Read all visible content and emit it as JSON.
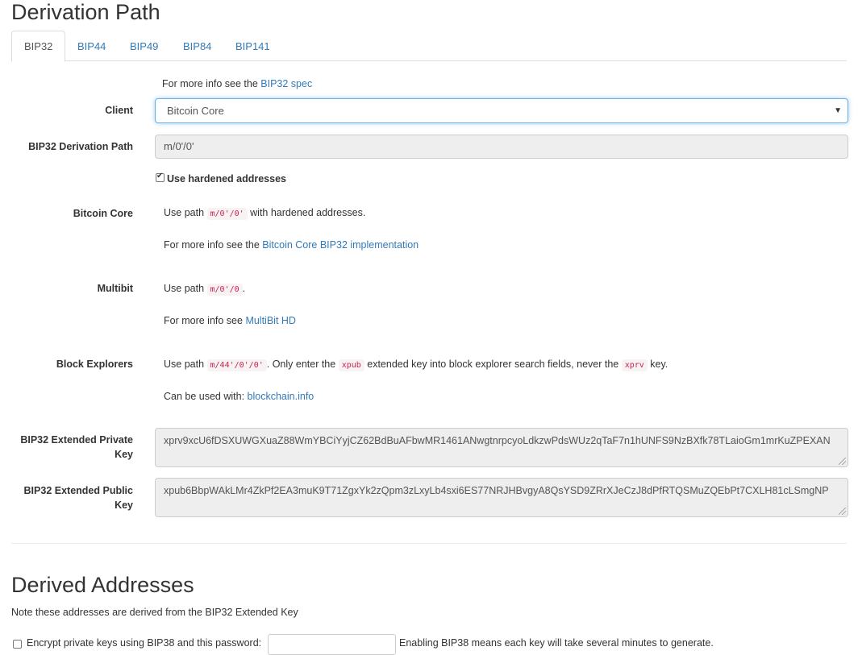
{
  "header": {
    "title": "Derivation Path"
  },
  "tabs": [
    {
      "label": "BIP32",
      "active": true
    },
    {
      "label": "BIP44"
    },
    {
      "label": "BIP49"
    },
    {
      "label": "BIP84"
    },
    {
      "label": "BIP141"
    }
  ],
  "bip32": {
    "info_prefix": "For more info see the ",
    "info_link": "BIP32 spec",
    "client_label": "Client",
    "client_value": "Bitcoin Core",
    "path_label": "BIP32 Derivation Path",
    "path_value": "m/0'/0'",
    "hardened_label": "Use hardened addresses",
    "hardened_checked": true,
    "bitcoin_core": {
      "label": "Bitcoin Core",
      "use_path": "Use path ",
      "path_code": "m/0'/0'",
      "suffix": " with hardened addresses.",
      "info_prefix": "For more info see the ",
      "info_link": "Bitcoin Core BIP32 implementation"
    },
    "multibit": {
      "label": "Multibit",
      "use_path": "Use path ",
      "path_code": "m/0'/0",
      "suffix": ".",
      "info_prefix": "For more info see ",
      "info_link": "MultiBit HD"
    },
    "block_explorers": {
      "label": "Block Explorers",
      "use_path": "Use path ",
      "path_code": "m/44'/0'/0'",
      "mid1": ". Only enter the ",
      "xpub_code": "xpub",
      "mid2": " extended key into block explorer search fields, never the ",
      "xprv_code": "xprv",
      "end": " key.",
      "used_prefix": "Can be used with: ",
      "used_link": "blockchain.info"
    },
    "ext_private_label_1": "BIP32 Extended Private",
    "ext_private_label_2": "Key",
    "ext_private_value": "xprv9xcU6fDSXUWGXuaZ88WmYBCiYyjCZ62BdBuAFbwMR1461ANwgtnrpcyoLdkzwPdsWUz2qTaF7n1hUNFS9NzBXfk78TLaioGm1mrKuZPEXAN",
    "ext_public_label_1": "BIP32 Extended Public",
    "ext_public_label_2": "Key",
    "ext_public_value": "xpub6BbpWAkLMr4ZkPf2EA3muK9T71ZgxYk2zQpm3zLxyLb4sxi6ES77NRJHBvgyA8QsYSD9ZRrXJeCzJ8dPfRTQSMuZQEbPt7CXLH81cLSmgNP"
  },
  "derived": {
    "title": "Derived Addresses",
    "note": "Note these addresses are derived from the BIP32 Extended Key",
    "bip38_label": "Encrypt private keys using BIP38 and this password:",
    "bip38_note": "Enabling BIP38 means each key will take several minutes to generate."
  }
}
